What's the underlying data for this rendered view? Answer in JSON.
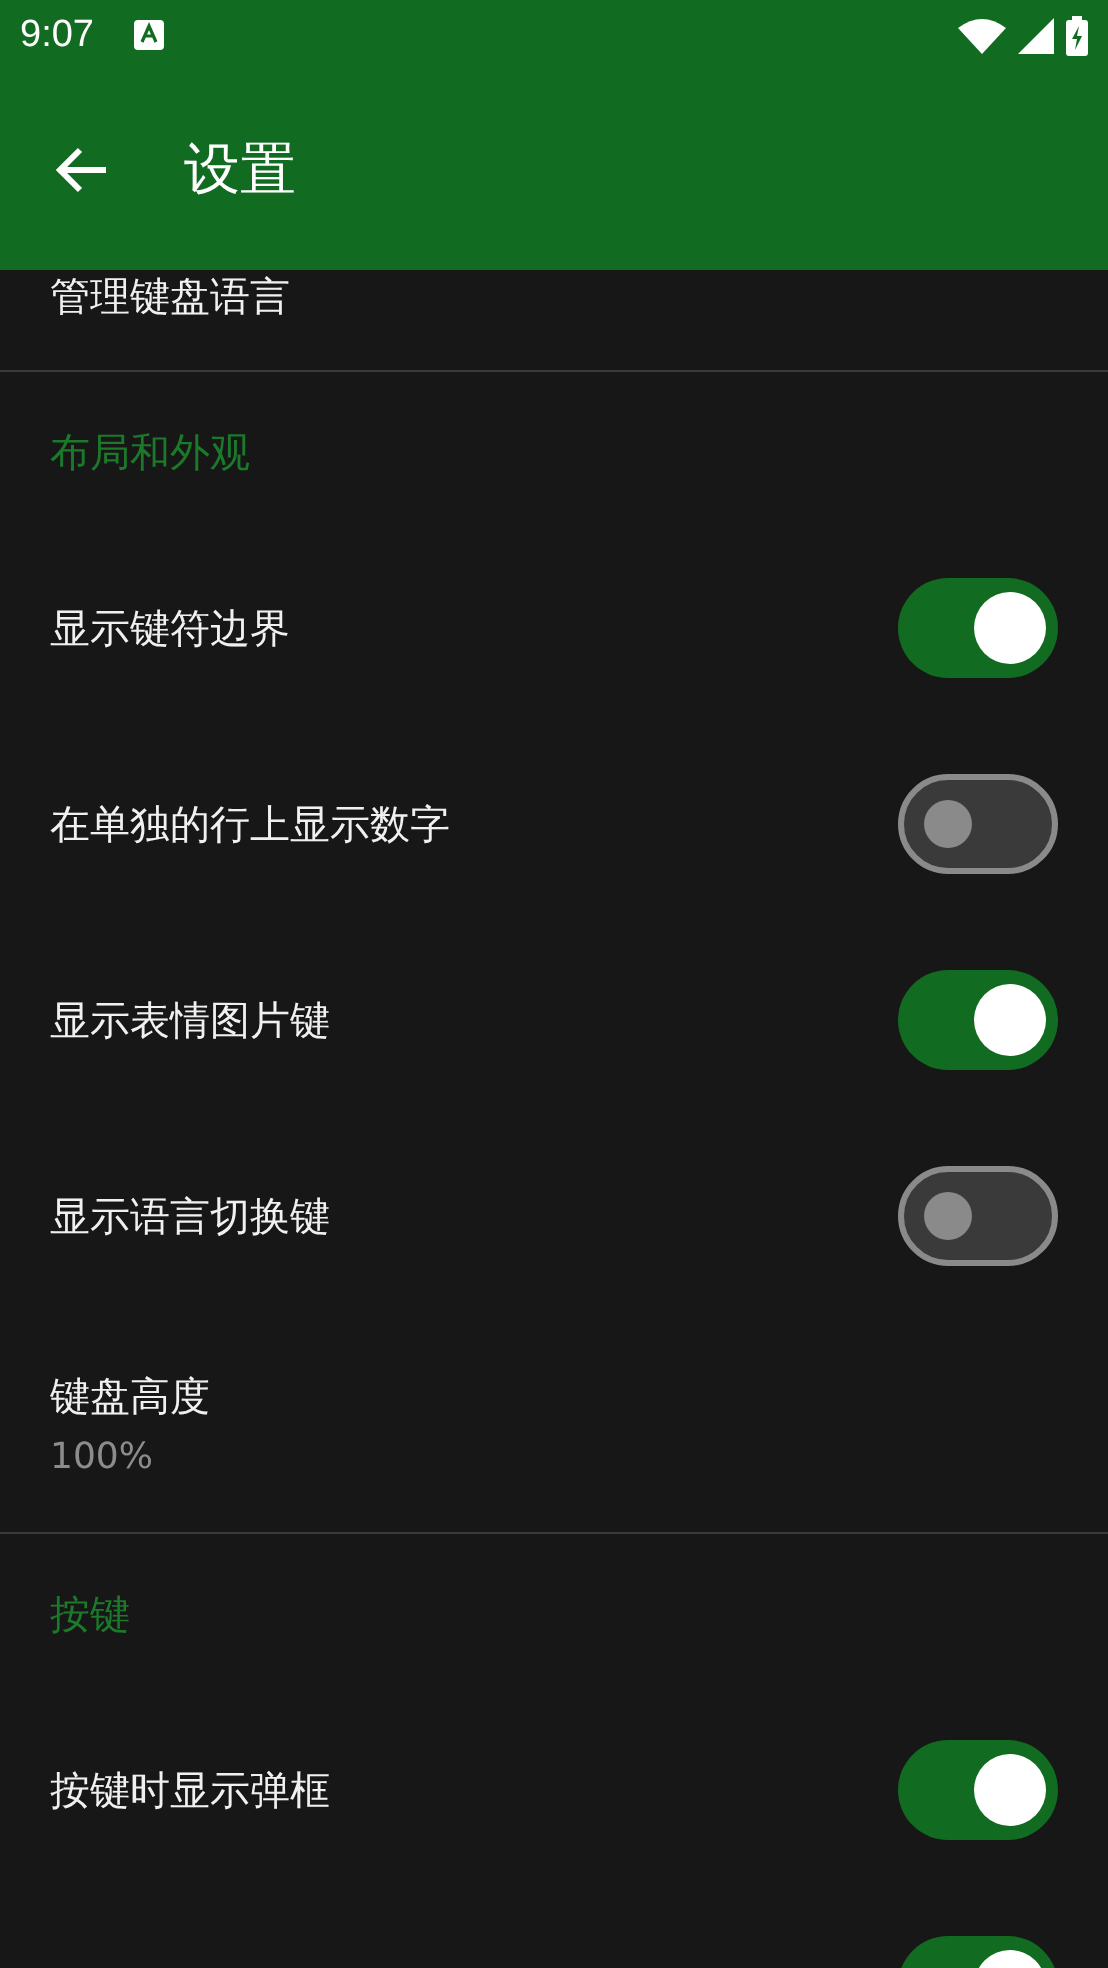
{
  "status_bar": {
    "time": "9:07"
  },
  "app_bar": {
    "title": "设置"
  },
  "sections": [
    {
      "items": [
        {
          "kind": "text",
          "title": "管理键盘语言"
        }
      ]
    },
    {
      "header": "布局和外观",
      "items": [
        {
          "kind": "toggle",
          "title": "显示键符边界",
          "on": true
        },
        {
          "kind": "toggle",
          "title": "在单独的行上显示数字",
          "on": false
        },
        {
          "kind": "toggle",
          "title": "显示表情图片键",
          "on": true
        },
        {
          "kind": "toggle",
          "title": "显示语言切换键",
          "on": false
        },
        {
          "kind": "text",
          "title": "键盘高度",
          "summary": "100%"
        }
      ]
    },
    {
      "header": "按键",
      "items": [
        {
          "kind": "toggle",
          "title": "按键时显示弹框",
          "on": true
        },
        {
          "kind": "toggle",
          "on": true
        }
      ]
    }
  ]
}
